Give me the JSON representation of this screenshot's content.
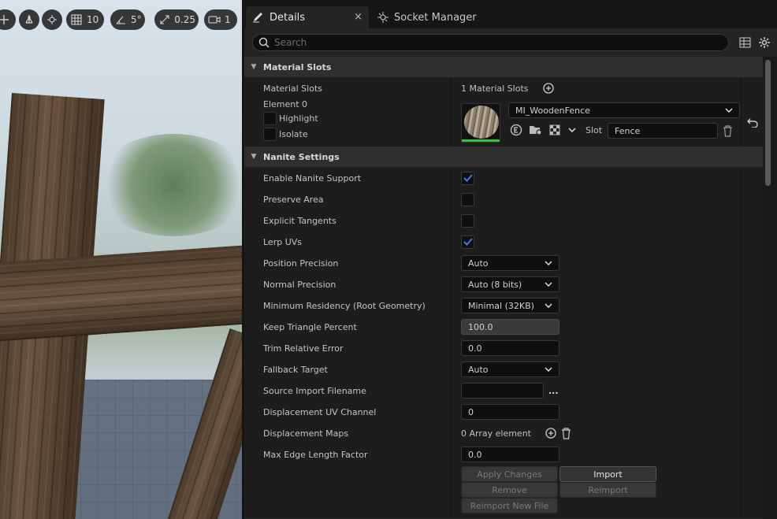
{
  "viewport_toolbar": {
    "grid_value": "10",
    "angle_value": "5°",
    "scale_value": "0.25",
    "camera_value": "1"
  },
  "tabs": {
    "details": "Details",
    "close": "×",
    "socket_manager": "Socket Manager"
  },
  "search": {
    "placeholder": "Search"
  },
  "material_slots": {
    "category": "Material Slots",
    "label": "Material Slots",
    "value": "1 Material Slots",
    "element_label": "Element 0",
    "highlight_label": "Highlight",
    "isolate_label": "Isolate",
    "material_name": "MI_WoodenFence",
    "slot_label": "Slot",
    "slot_value": "Fence"
  },
  "nanite": {
    "category": "Nanite Settings",
    "enable_nanite_support": "Enable Nanite Support",
    "preserve_area": "Preserve Area",
    "explicit_tangents": "Explicit Tangents",
    "lerp_uvs": "Lerp UVs",
    "position_precision": "Position Precision",
    "position_precision_value": "Auto",
    "normal_precision": "Normal Precision",
    "normal_precision_value": "Auto (8 bits)",
    "minimum_residency": "Minimum Residency (Root Geometry)",
    "minimum_residency_value": "Minimal (32KB)",
    "keep_triangle_percent": "Keep Triangle Percent",
    "keep_triangle_percent_value": "100.0",
    "trim_relative_error": "Trim Relative Error",
    "trim_relative_error_value": "0.0",
    "fallback_target": "Fallback Target",
    "fallback_target_value": "Auto",
    "source_import_filename": "Source Import Filename",
    "source_import_more": "...",
    "displacement_uv_channel": "Displacement UV Channel",
    "displacement_uv_channel_value": "0",
    "displacement_maps": "Displacement Maps",
    "displacement_maps_value": "0 Array element",
    "max_edge_length_factor": "Max Edge Length Factor",
    "max_edge_length_factor_value": "0.0"
  },
  "buttons": {
    "apply_changes": "Apply Changes",
    "import": "Import",
    "remove": "Remove",
    "reimport": "Reimport",
    "reimport_new_file": "Reimport New File"
  },
  "colors": {
    "accent_blue": "#2f7ff0",
    "thumb_green": "#34c232"
  }
}
